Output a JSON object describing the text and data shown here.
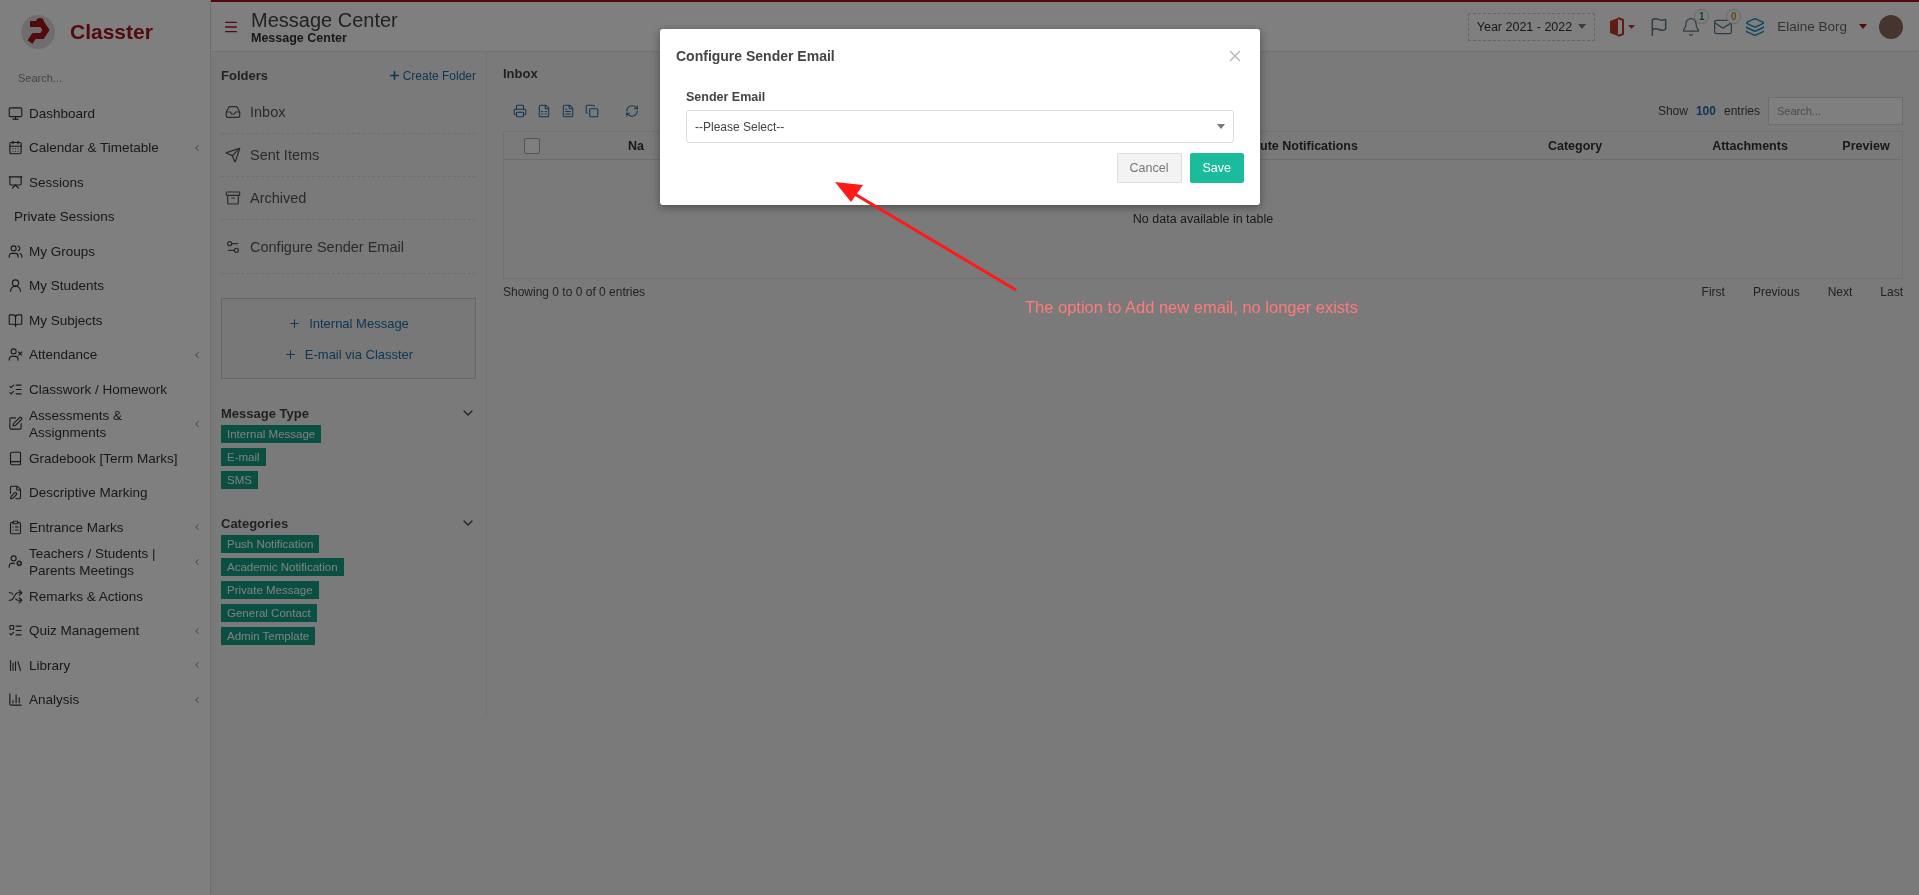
{
  "brand": {
    "name": "Classter"
  },
  "sidebar": {
    "search_placeholder": "Search...",
    "items": [
      {
        "label": "Dashboard",
        "kind": "icon",
        "has_submenu": false
      },
      {
        "label": "Calendar & Timetable",
        "kind": "icon",
        "has_submenu": true
      },
      {
        "label": "Sessions",
        "kind": "icon",
        "has_submenu": false
      },
      {
        "label": "Private Sessions",
        "kind": "plain",
        "has_submenu": false
      },
      {
        "label": "My Groups",
        "kind": "icon",
        "has_submenu": false
      },
      {
        "label": "My Students",
        "kind": "icon",
        "has_submenu": false
      },
      {
        "label": "My Subjects",
        "kind": "icon",
        "has_submenu": false
      },
      {
        "label": "Attendance",
        "kind": "icon",
        "has_submenu": true
      },
      {
        "label": "Classwork / Homework",
        "kind": "icon",
        "has_submenu": false
      },
      {
        "label": "Assessments & Assignments",
        "kind": "icon",
        "has_submenu": true
      },
      {
        "label": "Gradebook [Term Marks]",
        "kind": "icon",
        "has_submenu": false
      },
      {
        "label": "Descriptive Marking",
        "kind": "icon",
        "has_submenu": false
      },
      {
        "label": "Entrance Marks",
        "kind": "icon",
        "has_submenu": true
      },
      {
        "label": "Teachers / Students | Parents Meetings",
        "kind": "icon",
        "has_submenu": true
      },
      {
        "label": "Remarks & Actions",
        "kind": "icon",
        "has_submenu": false
      },
      {
        "label": "Quiz Management",
        "kind": "icon",
        "has_submenu": true
      },
      {
        "label": "Library",
        "kind": "icon",
        "has_submenu": true
      },
      {
        "label": "Analysis",
        "kind": "icon",
        "has_submenu": true
      }
    ]
  },
  "header": {
    "title": "Message Center",
    "subtitle": "Message Center",
    "year": "Year 2021 - 2022",
    "notifications": "1",
    "messages": "0",
    "user": "Elaine Borg"
  },
  "folders": {
    "title": "Folders",
    "create": "Create Folder",
    "items": [
      {
        "label": "Inbox"
      },
      {
        "label": "Sent Items"
      },
      {
        "label": "Archived"
      },
      {
        "label": "Configure Sender Email"
      }
    ],
    "compose": [
      "Internal Message",
      "E-mail via Classter"
    ]
  },
  "filters": [
    {
      "title": "Message Type",
      "tags": [
        "Internal Message",
        "E-mail",
        "SMS"
      ]
    },
    {
      "title": "Categories",
      "tags": [
        "Push Notification",
        "Academic Notification",
        "Private Message",
        "General Contact",
        "Admin Template"
      ]
    }
  ],
  "inbox": {
    "title": "Inbox",
    "show": "Show",
    "page_size": "100",
    "entries": "entries",
    "search_placeholder": "Search...",
    "select_all_checked": false,
    "columns": [
      "Na",
      "ute Notifications",
      "Category",
      "Attachments",
      "Preview"
    ],
    "empty": "No data available in table",
    "info": "Showing 0 to 0 of 0 entries",
    "pager": [
      "First",
      "Previous",
      "Next",
      "Last"
    ]
  },
  "modal": {
    "title": "Configure Sender Email",
    "field_label": "Sender Email",
    "placeholder": "--Please Select--",
    "buttons": [
      {
        "label": "Cancel",
        "kind": "secondary"
      },
      {
        "label": "Save",
        "kind": "primary"
      }
    ]
  },
  "annotation": {
    "text": "The option to Add new email, no longer exists"
  }
}
